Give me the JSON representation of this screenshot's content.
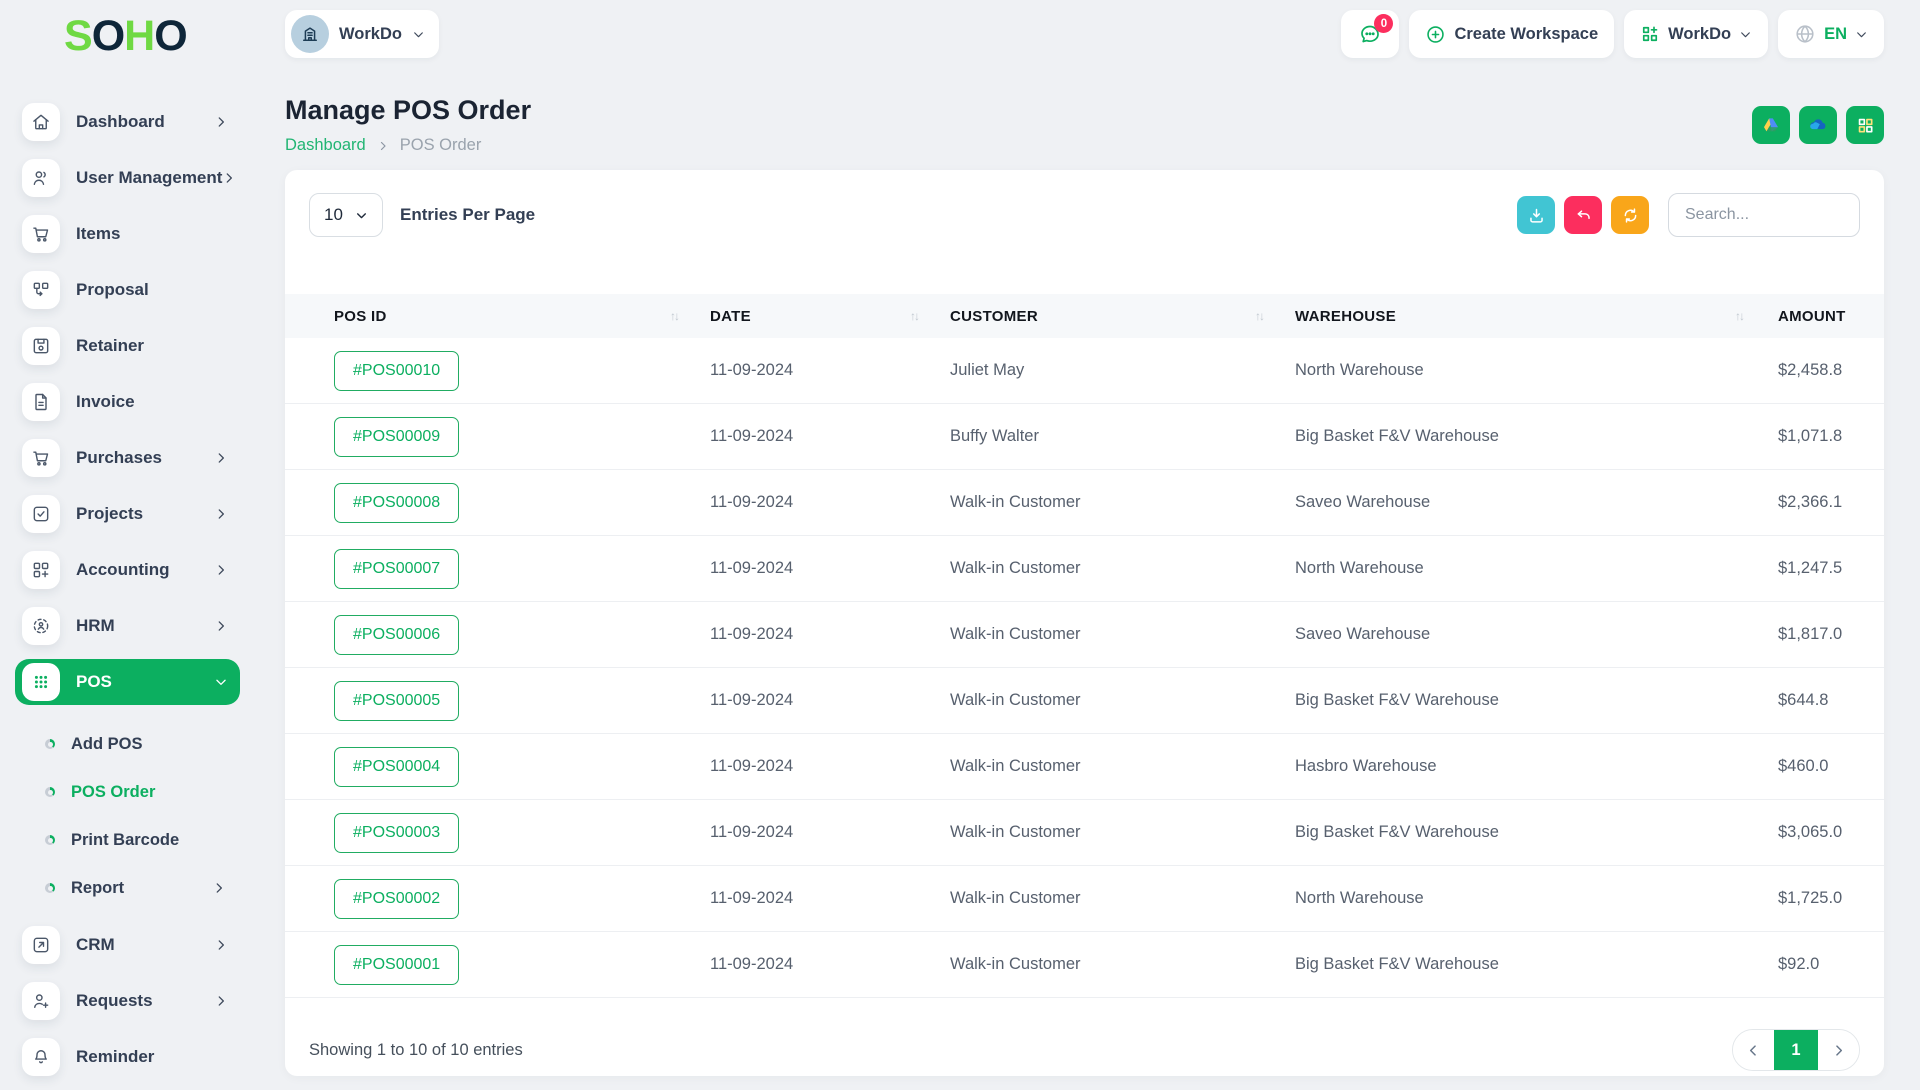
{
  "logo": {
    "letters": [
      "S",
      "O",
      "H",
      "O"
    ]
  },
  "header": {
    "workspace": {
      "name": "WorkDo"
    },
    "messenger_badge": "0",
    "create_workspace_label": "Create Workspace",
    "apps_menu_label": "WorkDo",
    "language": "EN"
  },
  "page": {
    "title": "Manage POS Order",
    "breadcrumb": {
      "home": "Dashboard",
      "current": "POS Order"
    }
  },
  "sidebar": {
    "items": [
      {
        "label": "Dashboard"
      },
      {
        "label": "User Management"
      },
      {
        "label": "Items"
      },
      {
        "label": "Proposal"
      },
      {
        "label": "Retainer"
      },
      {
        "label": "Invoice"
      },
      {
        "label": "Purchases"
      },
      {
        "label": "Projects"
      },
      {
        "label": "Accounting"
      },
      {
        "label": "HRM"
      },
      {
        "label": "POS"
      },
      {
        "label": "CRM"
      },
      {
        "label": "Requests"
      },
      {
        "label": "Reminder"
      }
    ],
    "pos_submenu": [
      {
        "label": "Add POS"
      },
      {
        "label": "POS Order"
      },
      {
        "label": "Print Barcode"
      },
      {
        "label": "Report"
      }
    ]
  },
  "toolbar": {
    "page_size": "10",
    "entries_label": "Entries Per Page",
    "search_placeholder": "Search..."
  },
  "table": {
    "columns": [
      {
        "label": "POS ID"
      },
      {
        "label": "DATE"
      },
      {
        "label": "CUSTOMER"
      },
      {
        "label": "WAREHOUSE"
      },
      {
        "label": "AMOUNT"
      }
    ],
    "rows": [
      {
        "pos_id": "#POS00010",
        "date": "11-09-2024",
        "customer": "Juliet May",
        "warehouse": "North Warehouse",
        "amount": "$2,458.8"
      },
      {
        "pos_id": "#POS00009",
        "date": "11-09-2024",
        "customer": "Buffy Walter",
        "warehouse": "Big Basket F&V Warehouse",
        "amount": "$1,071.8"
      },
      {
        "pos_id": "#POS00008",
        "date": "11-09-2024",
        "customer": "Walk-in Customer",
        "warehouse": "Saveo Warehouse",
        "amount": "$2,366.1"
      },
      {
        "pos_id": "#POS00007",
        "date": "11-09-2024",
        "customer": "Walk-in Customer",
        "warehouse": "North Warehouse",
        "amount": "$1,247.5"
      },
      {
        "pos_id": "#POS00006",
        "date": "11-09-2024",
        "customer": "Walk-in Customer",
        "warehouse": "Saveo Warehouse",
        "amount": "$1,817.0"
      },
      {
        "pos_id": "#POS00005",
        "date": "11-09-2024",
        "customer": "Walk-in Customer",
        "warehouse": "Big Basket F&V Warehouse",
        "amount": "$644.8"
      },
      {
        "pos_id": "#POS00004",
        "date": "11-09-2024",
        "customer": "Walk-in Customer",
        "warehouse": "Hasbro Warehouse",
        "amount": "$460.0"
      },
      {
        "pos_id": "#POS00003",
        "date": "11-09-2024",
        "customer": "Walk-in Customer",
        "warehouse": "Big Basket F&V Warehouse",
        "amount": "$3,065.0"
      },
      {
        "pos_id": "#POS00002",
        "date": "11-09-2024",
        "customer": "Walk-in Customer",
        "warehouse": "North Warehouse",
        "amount": "$1,725.0"
      },
      {
        "pos_id": "#POS00001",
        "date": "11-09-2024",
        "customer": "Walk-in Customer",
        "warehouse": "Big Basket F&V Warehouse",
        "amount": "$92.0"
      }
    ]
  },
  "pagination": {
    "showing_text": "Showing 1 to 10 of 10 entries",
    "current_page": "1"
  },
  "colors": {
    "brand_green": "#0caf60",
    "logo_green": "#6fd943",
    "logo_navy": "#0e2639",
    "badge_pink": "#fc2e5e",
    "download_teal": "#41c5d3",
    "undo_pink": "#fc2e5e",
    "refresh_orange": "#f9a61a",
    "header_bg": "#f6f8fa",
    "page_bg": "#eff1f4"
  }
}
